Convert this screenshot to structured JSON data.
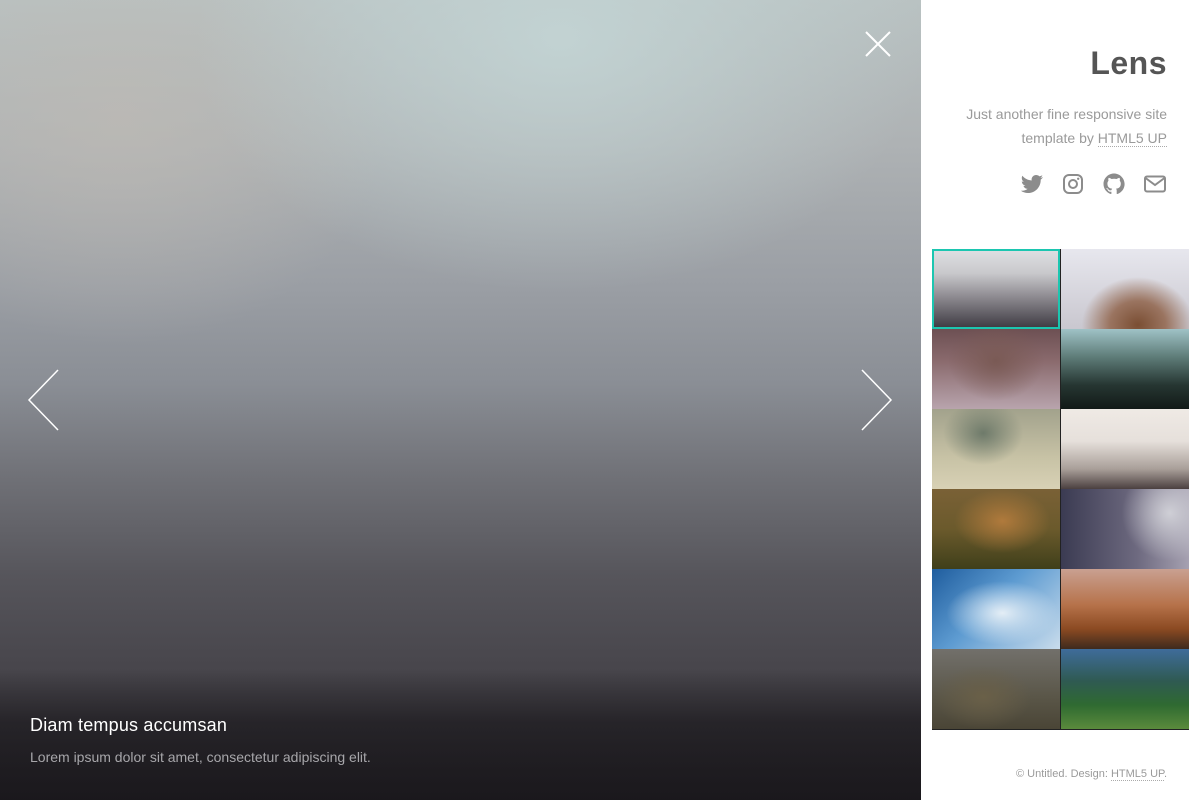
{
  "viewer": {
    "caption_title": "Diam tempus accumsan",
    "caption_text": "Lorem ipsum dolor sit amet, consectetur adipiscing elit.",
    "close_icon": "close-icon",
    "prev_icon": "chevron-left-icon",
    "next_icon": "chevron-right-icon"
  },
  "sidebar": {
    "brand": "Lens",
    "tagline_prefix": "Just another fine responsive site template by ",
    "tagline_link": "HTML5 UP",
    "social_icons": [
      "twitter-icon",
      "instagram-icon",
      "github-icon",
      "envelope-icon"
    ],
    "accent_color": "#1cc6b0",
    "thumbnails": [
      {
        "active": true
      },
      {
        "active": false
      },
      {
        "active": false
      },
      {
        "active": false
      },
      {
        "active": false
      },
      {
        "active": false
      },
      {
        "active": false
      },
      {
        "active": false
      },
      {
        "active": false
      },
      {
        "active": false
      },
      {
        "active": false
      },
      {
        "active": false
      }
    ],
    "footer_prefix": "© Untitled.  Design: ",
    "footer_link": "HTML5 UP",
    "footer_suffix": "."
  }
}
